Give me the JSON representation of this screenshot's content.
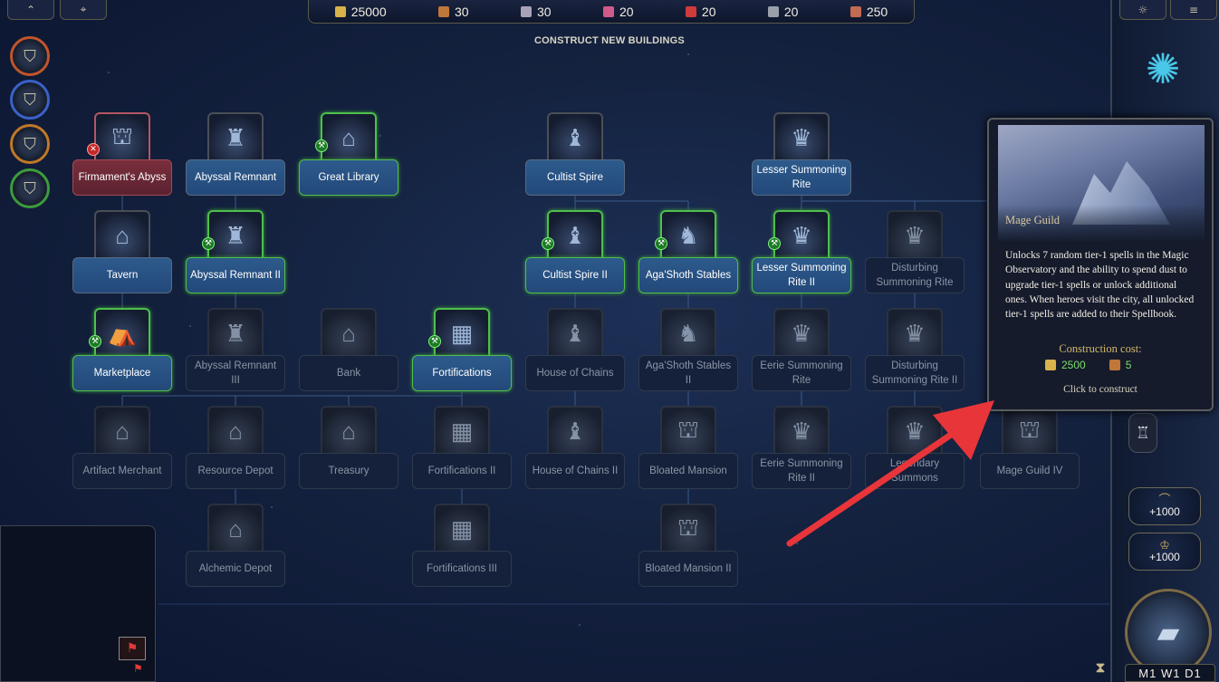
{
  "top": {
    "resources": [
      {
        "icon": "gold-icon",
        "value": "25000",
        "color": "#d8b24a"
      },
      {
        "icon": "wood-icon",
        "value": "30",
        "color": "#c0773a"
      },
      {
        "icon": "ore-icon",
        "value": "30",
        "color": "#a8a2b8"
      },
      {
        "icon": "mercury-icon",
        "value": "20",
        "color": "#d05a8a"
      },
      {
        "icon": "crystal-icon",
        "value": "20",
        "color": "#d03a3a"
      },
      {
        "icon": "gems-icon",
        "value": "20",
        "color": "#9aa0aa"
      },
      {
        "icon": "dust-icon",
        "value": "250",
        "color": "#c26a52"
      }
    ],
    "left_buttons": [
      {
        "icon": "collapse-icon",
        "glyph": "⌃"
      },
      {
        "icon": "map-pin-icon",
        "glyph": "⌖"
      }
    ],
    "right_buttons": [
      {
        "icon": "sun-icon",
        "glyph": "☼"
      },
      {
        "icon": "menu-icon",
        "glyph": "≡"
      }
    ]
  },
  "page_title": "CONSTRUCT NEW BUILDINGS",
  "buildings": [
    {
      "label": "Firmament's Abyss",
      "state": "red"
    },
    {
      "label": "Abyssal Remnant",
      "state": "built"
    },
    {
      "label": "Great Library",
      "state": "avail"
    },
    {
      "label": "Cultist Spire",
      "state": "built"
    },
    {
      "label": "Lesser Summoning Rite",
      "state": "built"
    },
    {
      "label": "Tavern",
      "state": "built"
    },
    {
      "label": "Abyssal Remnant II",
      "state": "avail"
    },
    {
      "label": "Cultist Spire II",
      "state": "avail"
    },
    {
      "label": "Aga'Shoth Stables",
      "state": "avail"
    },
    {
      "label": "Lesser Summoning Rite II",
      "state": "avail"
    },
    {
      "label": "Disturbing Summoning Rite",
      "state": "locked"
    },
    {
      "label": "Marketplace",
      "state": "avail"
    },
    {
      "label": "Abyssal Remnant III",
      "state": "locked"
    },
    {
      "label": "Bank",
      "state": "locked"
    },
    {
      "label": "Fortifications",
      "state": "avail"
    },
    {
      "label": "House of Chains",
      "state": "locked"
    },
    {
      "label": "Aga'Shoth Stables II",
      "state": "locked"
    },
    {
      "label": "Eerie Summoning Rite",
      "state": "locked"
    },
    {
      "label": "Disturbing Summoning Rite II",
      "state": "locked"
    },
    {
      "label": "Artifact Merchant",
      "state": "locked"
    },
    {
      "label": "Resource Depot",
      "state": "locked"
    },
    {
      "label": "Treasury",
      "state": "locked"
    },
    {
      "label": "Fortifications II",
      "state": "locked"
    },
    {
      "label": "House of Chains II",
      "state": "locked"
    },
    {
      "label": "Bloated Mansion",
      "state": "locked"
    },
    {
      "label": "Eerie Summoning Rite II",
      "state": "locked"
    },
    {
      "label": "Legendary Summons",
      "state": "locked"
    },
    {
      "label": "Mage Guild IV",
      "state": "locked"
    },
    {
      "label": "Alchemic Depot",
      "state": "locked"
    },
    {
      "label": "Fortifications III",
      "state": "locked"
    },
    {
      "label": "Bloated Mansion II",
      "state": "locked"
    }
  ],
  "tooltip": {
    "name": "Mage Guild",
    "description": "Unlocks 7 random tier-1 spells in the Magic Observatory and the ability to spend dust to upgrade tier-1 spells or unlock additional ones. When heroes visit the city, all unlocked tier-1 spells are added to their Spellbook.",
    "cost_label": "Construction cost:",
    "costs": [
      {
        "icon": "gold-icon",
        "value": "2500"
      },
      {
        "icon": "wood-icon",
        "value": "5"
      }
    ],
    "action": "Click to construct"
  },
  "sidebar": {
    "gold_buttons": [
      "+1000",
      "+1000"
    ],
    "date": "M1 W1 D1"
  },
  "colors": {
    "accent_green": "#4fbf4b",
    "annotation_arrow": "#e8353a"
  }
}
